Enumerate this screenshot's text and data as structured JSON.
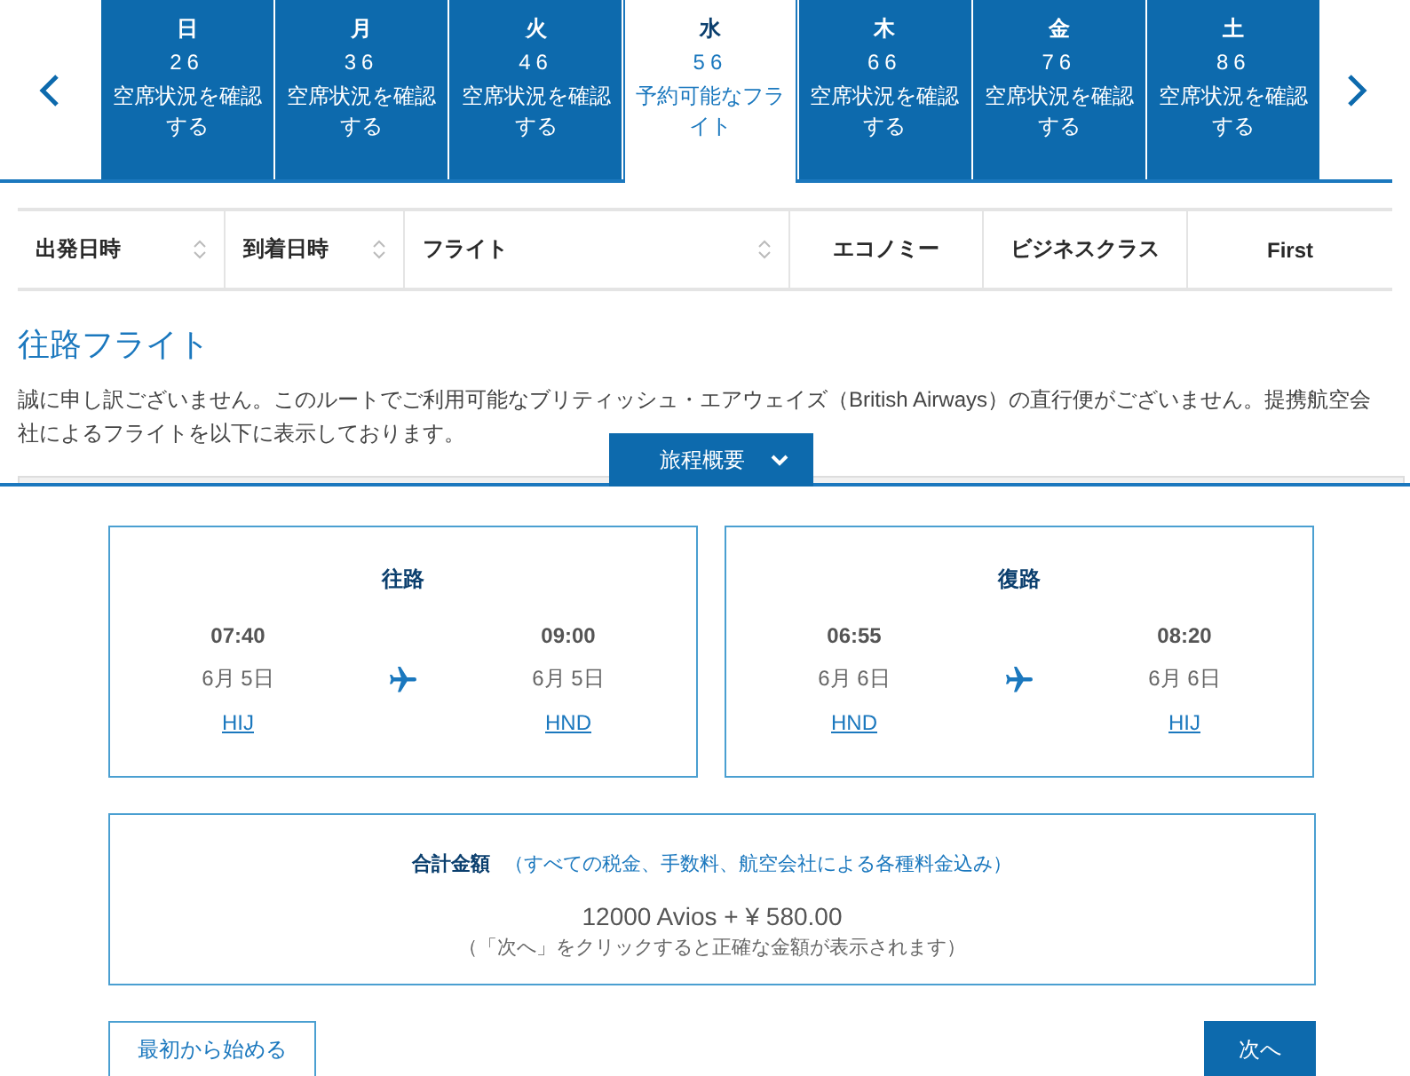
{
  "days": [
    {
      "weekday": "日",
      "date": "26",
      "status": "空席状況を確認する",
      "selected": false
    },
    {
      "weekday": "月",
      "date": "36",
      "status": "空席状況を確認する",
      "selected": false
    },
    {
      "weekday": "火",
      "date": "46",
      "status": "空席状況を確認する",
      "selected": false
    },
    {
      "weekday": "水",
      "date": "56",
      "status": "予約可能なフライト",
      "selected": true
    },
    {
      "weekday": "木",
      "date": "66",
      "status": "空席状況を確認する",
      "selected": false
    },
    {
      "weekday": "金",
      "date": "76",
      "status": "空席状況を確認する",
      "selected": false
    },
    {
      "weekday": "土",
      "date": "86",
      "status": "空席状況を確認する",
      "selected": false
    }
  ],
  "table": {
    "columns": [
      {
        "label": "出発日時",
        "kind": "sortable"
      },
      {
        "label": "到着日時",
        "kind": "sortable"
      },
      {
        "label": "フライト",
        "kind": "sortable"
      },
      {
        "label": "エコノミー",
        "kind": "plain"
      },
      {
        "label": "ビジネスクラス",
        "kind": "plain"
      },
      {
        "label": "First",
        "kind": "plain"
      }
    ]
  },
  "section_title": "往路フライト",
  "notice": "誠に申し訳ございません。このルートでご利用可能なブリティッシュ・エアウェイズ（British Airways）の直行便がございません。提携航空会社によるフライトを以下に表示しております。",
  "summary": {
    "toggle": "旅程概要",
    "expanded": true,
    "legs": [
      {
        "title": "往路",
        "depart_time": "07:40",
        "depart_date": "6月 5日",
        "depart_code": "HIJ",
        "arrive_time": "09:00",
        "arrive_date": "6月 5日",
        "arrive_code": "HND"
      },
      {
        "title": "復路",
        "depart_time": "06:55",
        "depart_date": "6月 6日",
        "depart_code": "HND",
        "arrive_time": "08:20",
        "arrive_date": "6月 6日",
        "arrive_code": "HIJ"
      }
    ],
    "total_label": "合計金額",
    "total_note": "（すべての税金、手数料、航空会社による各種料金込み）",
    "total_amount": "12000 Avios + ¥ 580.00",
    "total_hint": "（「次へ」をクリックすると正確な金額が表示されます）"
  },
  "buttons": {
    "restart": "最初から始める",
    "next": "次へ"
  }
}
